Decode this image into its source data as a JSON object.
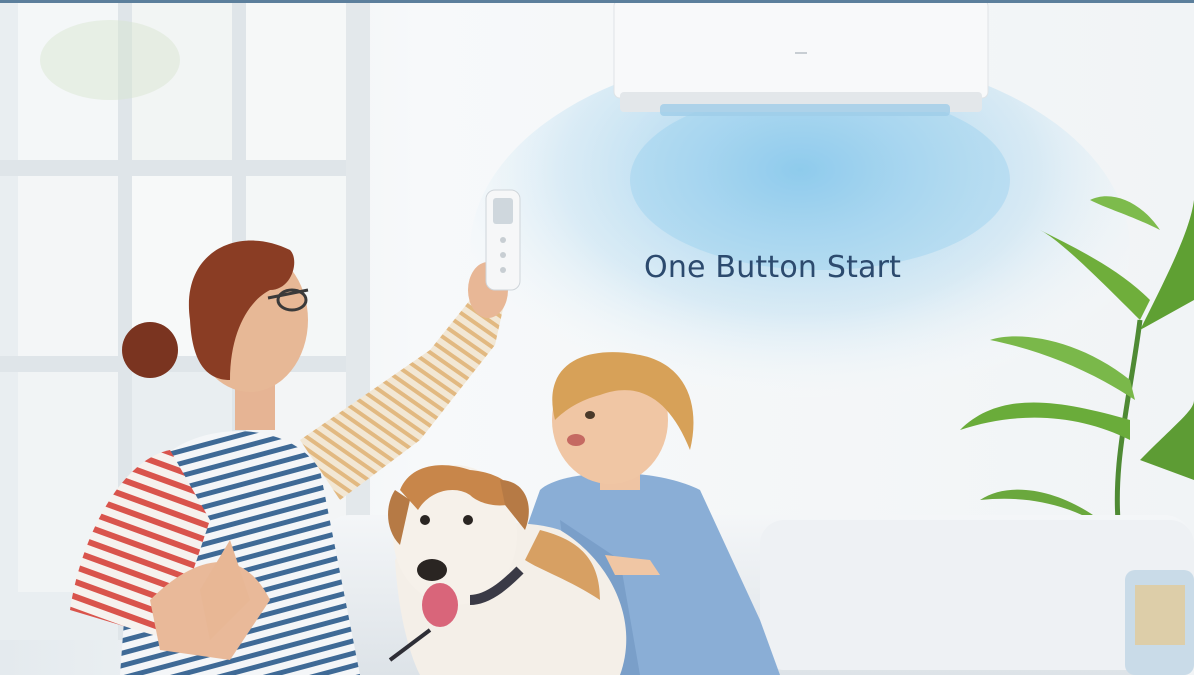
{
  "hero": {
    "headline": "One Button Start"
  },
  "colors": {
    "top_bar": "#5c7f9c",
    "headline": "#2c4a6e",
    "airflow": "#7ec3ea",
    "wall": "#f3f6f8"
  },
  "icons": {
    "ac_unit": "air-conditioner-icon",
    "remote": "remote-control-icon"
  }
}
